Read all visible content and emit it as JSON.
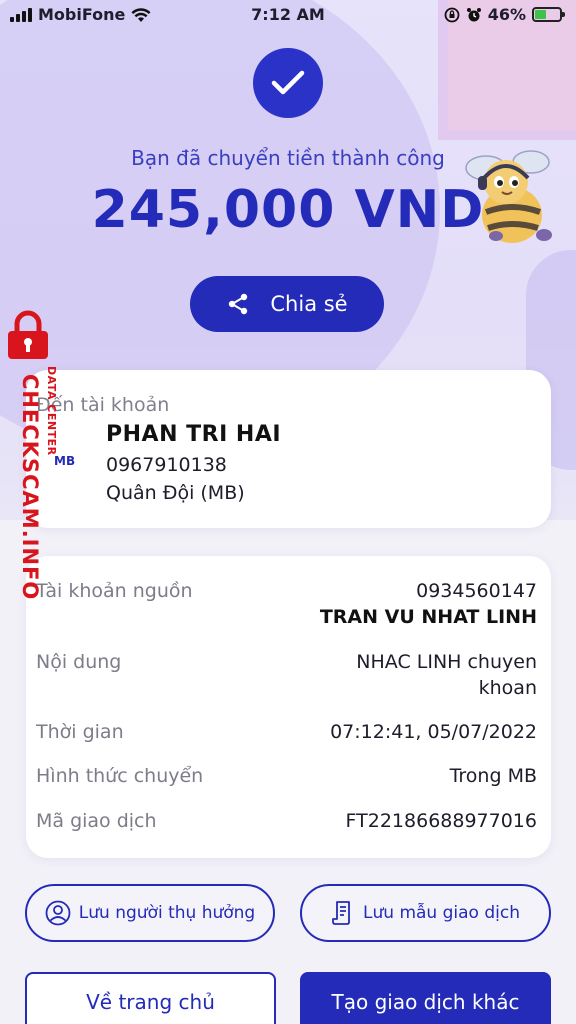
{
  "status_bar": {
    "carrier": "MobiFone",
    "time": "7:12 AM",
    "battery": "46%",
    "battery_level": 0.46,
    "wifi_icon": "wifi-icon",
    "battery_icon": "battery-icon"
  },
  "success": {
    "message": "Bạn đã chuyển tiền thành công",
    "amount": "245,000 VND",
    "icon": "checkmark-icon"
  },
  "share": {
    "label": "Chia sẻ",
    "icon": "share-icon"
  },
  "destination": {
    "label": "Đến tài khoản",
    "bank_logo": "MB",
    "name": "PHAN TRI HAI",
    "account": "0967910138",
    "bank": "Quân Đội (MB)"
  },
  "details": {
    "source_label": "Tài khoản nguồn",
    "source_account": "0934560147",
    "source_name": "TRAN VU NHAT LINH",
    "content_label": "Nội dung",
    "content_line1": "NHAC LINH chuyen",
    "content_line2": "khoan",
    "time_label": "Thời gian",
    "time_value": "07:12:41, 05/07/2022",
    "method_label": "Hình thức chuyển",
    "method_value": "Trong MB",
    "txid_label": "Mã giao dịch",
    "txid_value": "FT22186688977016"
  },
  "actions": {
    "save_recipient": "Lưu người thụ hưởng",
    "save_template": "Lưu mẫu giao dịch",
    "home": "Về trang chủ",
    "new_transaction": "Tạo giao dịch khác"
  },
  "watermark": {
    "main": "CHECKSCAM.INFO",
    "sub": "DATA CENTER"
  },
  "colors": {
    "primary": "#232bb8",
    "watermark": "#d8141c",
    "background": "#e7e3fb"
  }
}
